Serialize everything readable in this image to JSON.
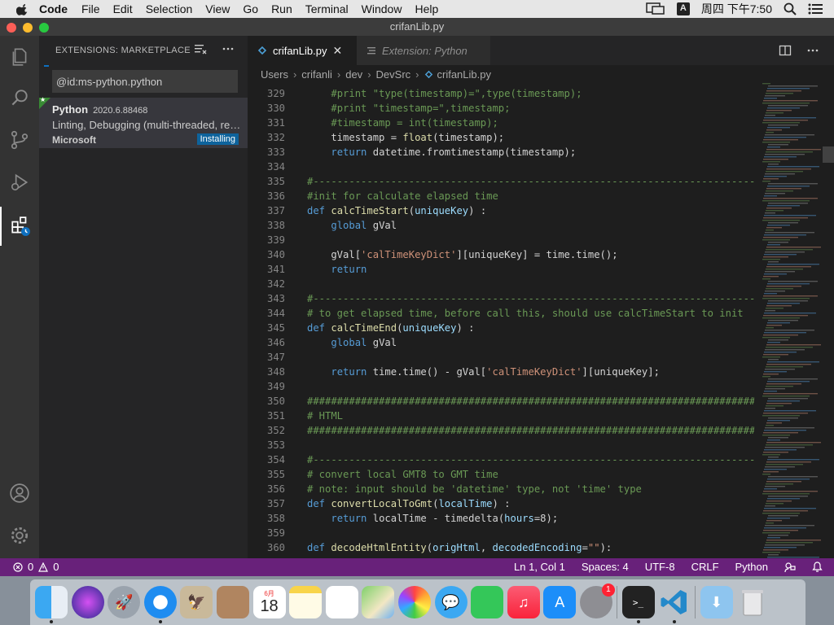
{
  "menubar": {
    "app": "Code",
    "items": [
      "File",
      "Edit",
      "Selection",
      "View",
      "Go",
      "Run",
      "Terminal",
      "Window",
      "Help"
    ],
    "input_method": "A",
    "clock": "周四 下午7:50"
  },
  "window": {
    "title": "crifanLib.py"
  },
  "sidebar": {
    "title": "EXTENSIONS: MARKETPLACE",
    "search_value": "@id:ms-python.python",
    "extension": {
      "name": "Python",
      "version": "2020.6.88468",
      "description": "Linting, Debugging (multi-threaded, remote), Intellisense, code formatting, refactoring, unit tests, and more.",
      "publisher": "Microsoft",
      "status": "Installing"
    }
  },
  "editor": {
    "tabs": [
      {
        "label": "crifanLib.py",
        "active": true
      },
      {
        "label": "Extension: Python",
        "active": false
      }
    ],
    "breadcrumb": [
      "Users",
      "crifanli",
      "dev",
      "DevSrc",
      "crifanLib.py"
    ],
    "lines": [
      {
        "n": "329",
        "segs": [
          {
            "t": "    "
          },
          {
            "c": "cm",
            "t": "#print \"type(timestamp)=\",type(timestamp);"
          }
        ]
      },
      {
        "n": "330",
        "segs": [
          {
            "t": "    "
          },
          {
            "c": "cm",
            "t": "#print \"timestamp=\",timestamp;"
          }
        ]
      },
      {
        "n": "331",
        "segs": [
          {
            "t": "    "
          },
          {
            "c": "cm",
            "t": "#timestamp = int(timestamp);"
          }
        ]
      },
      {
        "n": "332",
        "segs": [
          {
            "t": "    timestamp = "
          },
          {
            "c": "fn",
            "t": "float"
          },
          {
            "t": "(timestamp);"
          }
        ]
      },
      {
        "n": "333",
        "segs": [
          {
            "t": "    "
          },
          {
            "c": "kw",
            "t": "return"
          },
          {
            "t": " datetime.fromtimestamp(timestamp);"
          }
        ]
      },
      {
        "n": "334",
        "segs": []
      },
      {
        "n": "335",
        "segs": [
          {
            "c": "cm",
            "t": "#------------------------------------------------------------------------------"
          }
        ]
      },
      {
        "n": "336",
        "segs": [
          {
            "c": "cm",
            "t": "#init for calculate elapsed time"
          }
        ]
      },
      {
        "n": "337",
        "segs": [
          {
            "c": "kw",
            "t": "def"
          },
          {
            "t": " "
          },
          {
            "c": "fn",
            "t": "calcTimeStart"
          },
          {
            "t": "("
          },
          {
            "c": "pa",
            "t": "uniqueKey"
          },
          {
            "t": ") :"
          }
        ]
      },
      {
        "n": "338",
        "segs": [
          {
            "t": "    "
          },
          {
            "c": "kw",
            "t": "global"
          },
          {
            "t": " gVal"
          }
        ]
      },
      {
        "n": "339",
        "segs": []
      },
      {
        "n": "340",
        "segs": [
          {
            "t": "    gVal["
          },
          {
            "c": "st",
            "t": "'calTimeKeyDict'"
          },
          {
            "t": "][uniqueKey] = time.time();"
          }
        ]
      },
      {
        "n": "341",
        "segs": [
          {
            "t": "    "
          },
          {
            "c": "kw",
            "t": "return"
          }
        ]
      },
      {
        "n": "342",
        "segs": []
      },
      {
        "n": "343",
        "segs": [
          {
            "c": "cm",
            "t": "#------------------------------------------------------------------------------"
          }
        ]
      },
      {
        "n": "344",
        "segs": [
          {
            "c": "cm",
            "t": "# to get elapsed time, before call this, should use calcTimeStart to init"
          }
        ]
      },
      {
        "n": "345",
        "segs": [
          {
            "c": "kw",
            "t": "def"
          },
          {
            "t": " "
          },
          {
            "c": "fn",
            "t": "calcTimeEnd"
          },
          {
            "t": "("
          },
          {
            "c": "pa",
            "t": "uniqueKey"
          },
          {
            "t": ") :"
          }
        ]
      },
      {
        "n": "346",
        "segs": [
          {
            "t": "    "
          },
          {
            "c": "kw",
            "t": "global"
          },
          {
            "t": " gVal"
          }
        ]
      },
      {
        "n": "347",
        "segs": []
      },
      {
        "n": "348",
        "segs": [
          {
            "t": "    "
          },
          {
            "c": "kw",
            "t": "return"
          },
          {
            "t": " time.time() - gVal["
          },
          {
            "c": "st",
            "t": "'calTimeKeyDict'"
          },
          {
            "t": "][uniqueKey];"
          }
        ]
      },
      {
        "n": "349",
        "segs": []
      },
      {
        "n": "350",
        "segs": [
          {
            "c": "cm",
            "t": "################################################################################"
          }
        ]
      },
      {
        "n": "351",
        "segs": [
          {
            "c": "cm",
            "t": "# HTML"
          }
        ]
      },
      {
        "n": "352",
        "segs": [
          {
            "c": "cm",
            "t": "################################################################################"
          }
        ]
      },
      {
        "n": "353",
        "segs": []
      },
      {
        "n": "354",
        "segs": [
          {
            "c": "cm",
            "t": "#------------------------------------------------------------------------------"
          }
        ]
      },
      {
        "n": "355",
        "segs": [
          {
            "c": "cm",
            "t": "# convert local GMT8 to GMT time"
          }
        ]
      },
      {
        "n": "356",
        "segs": [
          {
            "c": "cm",
            "t": "# note: input should be 'datetime' type, not 'time' type"
          }
        ]
      },
      {
        "n": "357",
        "segs": [
          {
            "c": "kw",
            "t": "def"
          },
          {
            "t": " "
          },
          {
            "c": "fn",
            "t": "convertLocalToGmt"
          },
          {
            "t": "("
          },
          {
            "c": "pa",
            "t": "localTime"
          },
          {
            "t": ") :"
          }
        ]
      },
      {
        "n": "358",
        "segs": [
          {
            "t": "    "
          },
          {
            "c": "kw",
            "t": "return"
          },
          {
            "t": " localTime - timedelta("
          },
          {
            "c": "pa",
            "t": "hours"
          },
          {
            "t": "=8);"
          }
        ]
      },
      {
        "n": "359",
        "segs": []
      },
      {
        "n": "360",
        "segs": [
          {
            "c": "kw",
            "t": "def"
          },
          {
            "t": " "
          },
          {
            "c": "fn",
            "t": "decodeHtmlEntity"
          },
          {
            "t": "("
          },
          {
            "c": "pa",
            "t": "origHtml"
          },
          {
            "t": ", "
          },
          {
            "c": "pa",
            "t": "decodedEncoding"
          },
          {
            "t": "="
          },
          {
            "c": "st",
            "t": "\"\""
          },
          {
            "t": "):"
          }
        ]
      }
    ]
  },
  "statusbar": {
    "errors": "0",
    "warnings": "0",
    "position": "Ln 1, Col 1",
    "spaces": "Spaces: 4",
    "encoding": "UTF-8",
    "eol": "CRLF",
    "language": "Python"
  },
  "dock": {
    "calendar_month": "6月",
    "calendar_day": "18",
    "badge_count": "1"
  },
  "colors": {
    "statusbar": "#68217a",
    "activitybar": "#333333",
    "sidebar": "#252526",
    "editor": "#1e1e1e",
    "accent": "#0e639c"
  }
}
